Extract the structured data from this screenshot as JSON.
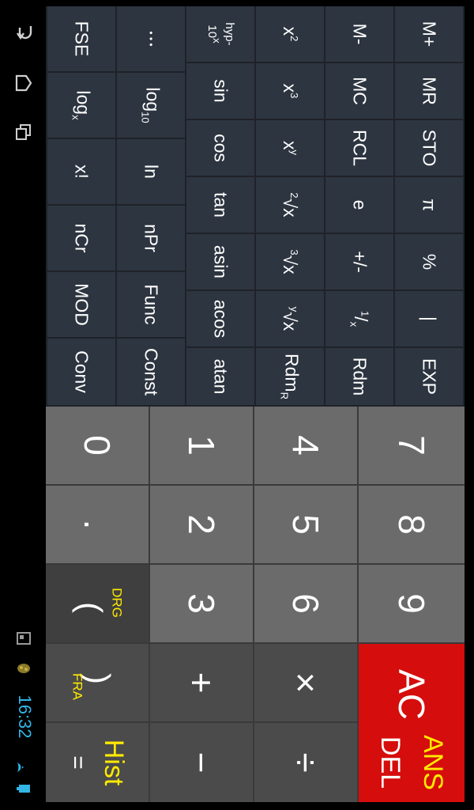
{
  "status": {
    "time": "16:32"
  },
  "nav": {
    "icons": [
      "back-icon",
      "home-icon",
      "recent-apps-icon"
    ]
  },
  "colors": {
    "accent_blue": "#33b5e5",
    "yellow": "#ffea00",
    "ac_red": "#d50d0d",
    "function_key": "#2d3540",
    "number_key": "#6b6b6b",
    "op_key": "#4b4b4b"
  },
  "keys": {
    "memory": {
      "mplus": "M+",
      "mr": "MR",
      "sto": "STO",
      "pi": "π",
      "percent": "%",
      "bar": "|",
      "exp": "EXP"
    },
    "row2": {
      "mminus": "M-",
      "mc": "MC",
      "rcl": "RCL",
      "e": "e",
      "plusminus": "+/-",
      "recip_num": "1",
      "recip_den": "x",
      "rdm": "Rdm"
    },
    "row3": {
      "xsq_base": "x",
      "xsq_exp": "2",
      "xcube_base": "x",
      "xcube_exp": "3",
      "xpow_base": "x",
      "xpow_exp": "y",
      "sqrt_idx": "2",
      "sqrt_body": "√x",
      "cbrt_idx": "3",
      "cbrt_body": "√x",
      "yroot_idx": "y",
      "yroot_body": "√x",
      "rdmr_base": "Rdm",
      "rdmr_sub": "R"
    },
    "trig": {
      "hyp_top": "hyp-",
      "hyp_bot_base": "10",
      "hyp_bot_exp": "x",
      "sin": "sin",
      "cos": "cos",
      "tan": "tan",
      "asin": "asin",
      "acos": "acos",
      "atan": "atan"
    },
    "row5": {
      "dots": "• • •",
      "log_base": "log",
      "log_sub": "10",
      "ln": "ln",
      "npr": "nPr",
      "func": "Func",
      "const": "Const"
    },
    "row6": {
      "fse": "FSE",
      "logx_base": "log",
      "logx_sub": "x",
      "fact": "x!",
      "ncr": "nCr",
      "mod": "MOD",
      "conv": "Conv"
    },
    "digits": {
      "d0": "0",
      "d1": "1",
      "d2": "2",
      "d3": "3",
      "d4": "4",
      "d5": "5",
      "d6": "6",
      "d7": "7",
      "d8": "8",
      "d9": "9",
      "dot": "."
    },
    "ops": {
      "drg": "DRG",
      "open_paren": "(",
      "close_paren": ")",
      "fra": "FRA",
      "equals": "=",
      "hist": "Hist",
      "plus": "+",
      "minus": "−",
      "times": "×",
      "divide": "÷",
      "ac": "AC",
      "del": "DEL",
      "ans": "ANS"
    }
  }
}
